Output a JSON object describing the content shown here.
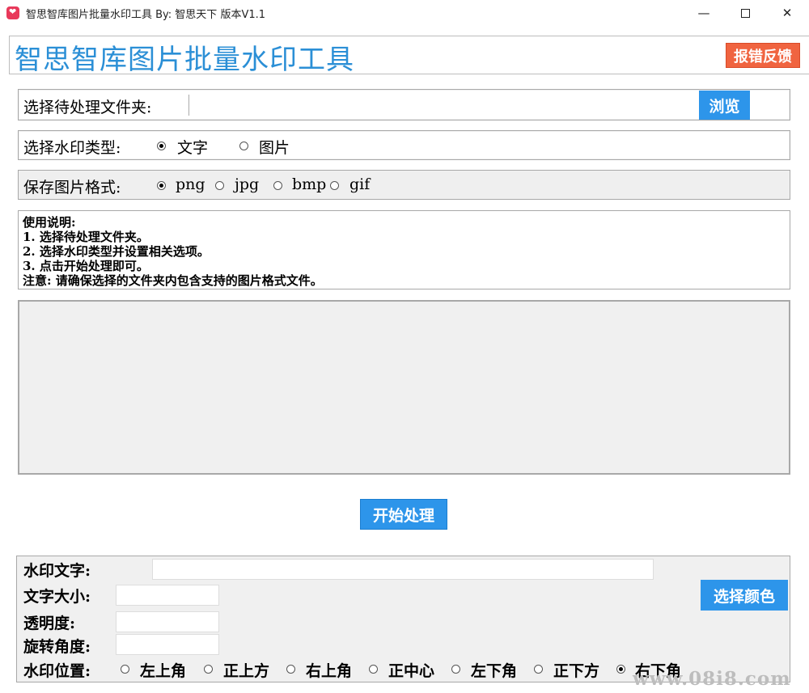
{
  "window": {
    "title": "智思智库图片批量水印工具   By:  智思天下 版本V1.1",
    "minimize": "—",
    "close": "✕"
  },
  "header": {
    "title": "智思智库图片批量水印工具",
    "feedback_label": "报错反馈"
  },
  "folder": {
    "label": "选择待处理文件夹:",
    "value": "",
    "browse_label": "浏览"
  },
  "watermark_type": {
    "label": "选择水印类型:",
    "options": [
      "文字",
      "图片"
    ],
    "selected": "文字"
  },
  "save_format": {
    "label": "保存图片格式:",
    "options": [
      "png",
      "jpg",
      "bmp",
      "gif"
    ],
    "selected": "png"
  },
  "instructions": [
    "使用说明:",
    "1. 选择待处理文件夹。",
    "2. 选择水印类型并设置相关选项。",
    "3. 点击开始处理即可。",
    "注意: 请确保选择的文件夹内包含支持的图片格式文件。"
  ],
  "start_label": "开始处理",
  "settings": {
    "text_label": "水印文字:",
    "size_label": "文字大小:",
    "opacity_label": "透明度:",
    "rotation_label": "旋转角度:",
    "position_label": "水印位置:",
    "color_button": "选择颜色",
    "positions": [
      "左上角",
      "正上方",
      "右上角",
      "正中心",
      "左下角",
      "正下方",
      "右下角"
    ],
    "selected_position": "右下角"
  },
  "site_watermark": "www.08i8.com",
  "colors": {
    "accent_blue": "#2d95ea",
    "feedback_orange": "#f06440",
    "title_blue": "#2b8fd6"
  }
}
